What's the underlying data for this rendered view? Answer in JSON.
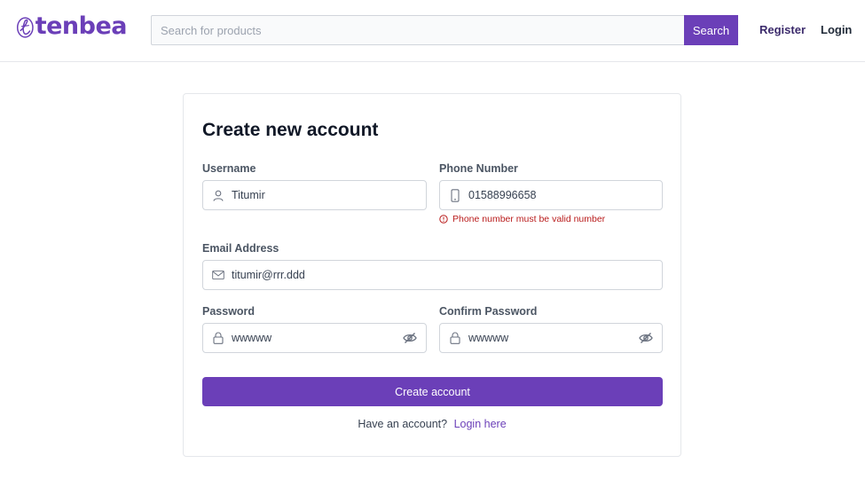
{
  "header": {
    "logo_text": "tenbea",
    "search_placeholder": "Search for products",
    "search_button": "Search",
    "register_link": "Register",
    "login_link": "Login"
  },
  "form": {
    "title": "Create new account",
    "username": {
      "label": "Username",
      "value": "Titumir",
      "icon": "user-icon"
    },
    "phone": {
      "label": "Phone Number",
      "value": "01588996658",
      "icon": "phone-icon",
      "error": "Phone number must be valid number"
    },
    "email": {
      "label": "Email Address",
      "value": "titumir@rrr.ddd",
      "icon": "envelope-icon"
    },
    "password": {
      "label": "Password",
      "value": "wwwww",
      "icon": "lock-icon"
    },
    "confirm_password": {
      "label": "Confirm Password",
      "value": "wwwww",
      "icon": "lock-icon"
    },
    "submit_label": "Create account",
    "footer_text": "Have an account?",
    "footer_link": "Login here"
  },
  "colors": {
    "brand": "#6b3fb8",
    "error": "#b91c1c"
  }
}
